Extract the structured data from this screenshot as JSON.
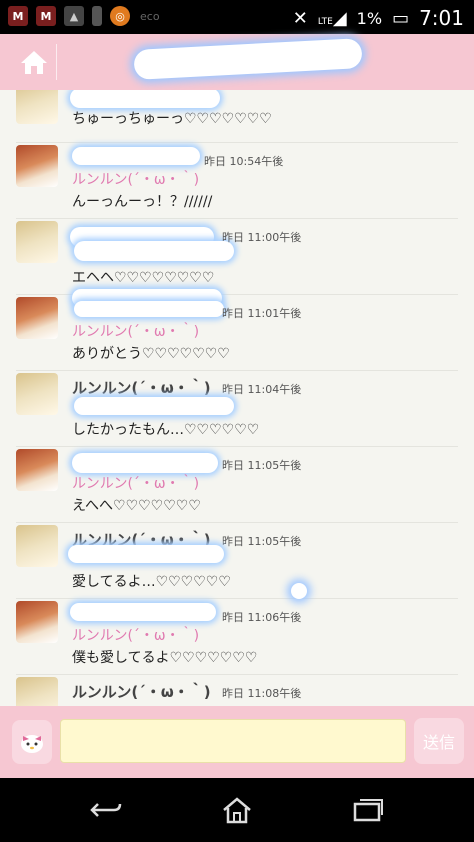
{
  "status_bar": {
    "signal": "LTE",
    "battery": "1%",
    "time": "7:01",
    "eco_label": "eco",
    "icons": [
      "mcafee-icon",
      "mcafee-icon",
      "picture-icon",
      "battery-small-icon",
      "orange-circle-icon",
      "vibrate-icon",
      "lte-signal-icon",
      "battery-icon"
    ]
  },
  "header": {
    "home_icon": "home-icon"
  },
  "messages": [
    {
      "name": "",
      "name2": "",
      "time": "",
      "text": "ちゅーっちゅーっ♡♡♡♡♡♡♡",
      "avatar": "hair-blond"
    },
    {
      "name": "",
      "name2": "ルンルン(´・ω・｀)",
      "time": "昨日 10:54午後",
      "text": "んーっんーっ！？//////",
      "avatar": "hair-red"
    },
    {
      "name": "",
      "name2": "",
      "time": "昨日 11:00午後",
      "text": "エヘヘ♡♡♡♡♡♡♡♡",
      "avatar": "hair-blond"
    },
    {
      "name": "",
      "name2": "ルンルン(´・ω・｀)",
      "time": "昨日 11:01午後",
      "text": "ありがとう♡♡♡♡♡♡♡",
      "avatar": "hair-red"
    },
    {
      "name": "ルンルン(´・ω・｀)",
      "name2": "",
      "time": "昨日 11:04午後",
      "text": "したかったもん…♡♡♡♡♡♡",
      "avatar": "hair-blond"
    },
    {
      "name": "",
      "name2": "ルンルン(´・ω・｀)",
      "time": "昨日 11:05午後",
      "text": "えへへ♡♡♡♡♡♡♡",
      "avatar": "hair-red"
    },
    {
      "name": "ルンルン(´・ω・｀)",
      "name2": "",
      "time": "昨日 11:05午後",
      "text": "愛してるよ…♡♡♡♡♡♡",
      "avatar": "hair-blond"
    },
    {
      "name": "",
      "name2": "ルンルン(´・ω・｀)",
      "time": "昨日 11:06午後",
      "text": "僕も愛してるよ♡♡♡♡♡♡♡",
      "avatar": "hair-red"
    },
    {
      "name": "ルンルン(´・ω・｀)",
      "name2": "",
      "time": "昨日 11:08午後",
      "text": "",
      "avatar": "hair-blond"
    }
  ],
  "input_bar": {
    "message_value": "",
    "send_label": "送信",
    "sticker_icon": "sticker-icon"
  },
  "nav_bar": {
    "icons": [
      "back-icon",
      "home-icon",
      "recents-icon"
    ]
  }
}
